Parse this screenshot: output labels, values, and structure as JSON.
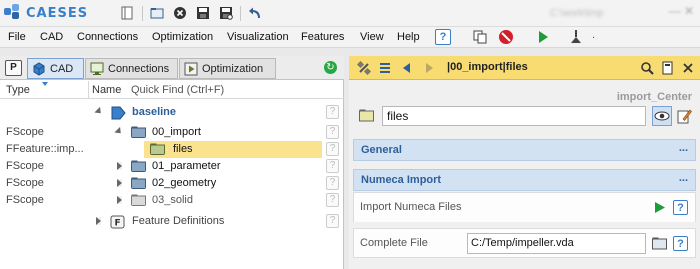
{
  "app": {
    "logo_text": "CAESES",
    "path_hint": "C:\\work\\tmp",
    "window_controls": "—  ✕"
  },
  "menu": {
    "items": [
      "File",
      "CAD",
      "Connections",
      "Optimization",
      "Visualization",
      "Features",
      "View",
      "Help"
    ],
    "help_label": "?"
  },
  "left_panel": {
    "p_label": "P",
    "tabs": [
      {
        "label": "CAD",
        "active": true,
        "icon": "cad-cube-icon"
      },
      {
        "label": "Connections",
        "active": false,
        "icon": "monitor-icon"
      },
      {
        "label": "Optimization",
        "active": false,
        "icon": "play-icon"
      }
    ],
    "refresh_glyph": "↻",
    "columns": {
      "type": "Type",
      "name": "Name",
      "quick_find": "Quick Find (Ctrl+F)"
    },
    "rows": [
      {
        "type": "",
        "name": "baseline",
        "expanded": true,
        "selected": false
      },
      {
        "type": "FScope",
        "name": "00_import",
        "expanded": true,
        "selected": false
      },
      {
        "type": "FFeature::imp...",
        "name": "files",
        "expanded": false,
        "selected": true
      },
      {
        "type": "FScope",
        "name": "01_parameter",
        "expanded": false,
        "selected": false
      },
      {
        "type": "FScope",
        "name": "02_geometry",
        "expanded": false,
        "selected": false
      },
      {
        "type": "FScope",
        "name": "03_solid",
        "expanded": false,
        "selected": false
      },
      {
        "type": "",
        "name": "Feature Definitions",
        "expanded": false,
        "selected": false
      }
    ],
    "qmark": "?"
  },
  "right_panel": {
    "breadcrumb": "|00_import|files",
    "object_name": "files",
    "import_center": "import_Center",
    "sections": {
      "general": "General",
      "numeca": "Numeca Import",
      "more": "..."
    },
    "import_label": "Import Numeca Files",
    "complete_file_label": "Complete File",
    "complete_file_value": "C:/Temp/impeller.vda",
    "qmark": "?"
  },
  "colors": {
    "accent": "#3a7fc9",
    "selection": "#fbe38e",
    "toolbar_yellow": "#f8dc72",
    "section_blue": "#d3e2f3",
    "run_green": "#1e9c3a",
    "stop_red": "#d21f2a"
  }
}
